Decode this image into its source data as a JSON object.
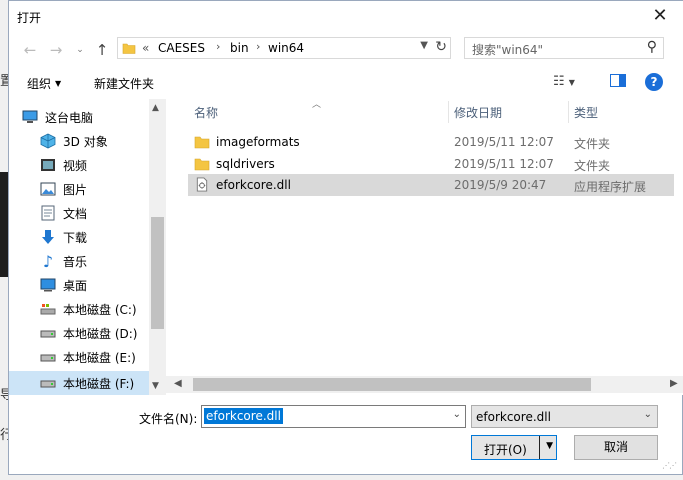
{
  "dialog": {
    "title": "打开",
    "close_glyph": "✕"
  },
  "address": {
    "overflow": "«",
    "crumbs": [
      "CAESES",
      "bin",
      "win64"
    ],
    "separator": "›"
  },
  "search": {
    "placeholder": "搜索\"win64\""
  },
  "toolbar": {
    "organize": "组织",
    "new_folder": "新建文件夹",
    "help": "?"
  },
  "nav": {
    "items": [
      {
        "label": "这台电脑",
        "icon": "computer-icon"
      },
      {
        "label": "3D 对象",
        "icon": "3d-objects-icon"
      },
      {
        "label": "视频",
        "icon": "video-icon"
      },
      {
        "label": "图片",
        "icon": "pictures-icon"
      },
      {
        "label": "文档",
        "icon": "documents-icon"
      },
      {
        "label": "下载",
        "icon": "download-icon"
      },
      {
        "label": "音乐",
        "icon": "music-icon"
      },
      {
        "label": "桌面",
        "icon": "desktop-icon"
      },
      {
        "label": "本地磁盘 (C:)",
        "icon": "drive-c-icon"
      },
      {
        "label": "本地磁盘 (D:)",
        "icon": "drive-icon"
      },
      {
        "label": "本地磁盘 (E:)",
        "icon": "drive-icon"
      },
      {
        "label": "本地磁盘 (F:)",
        "icon": "drive-icon"
      }
    ]
  },
  "filelist": {
    "columns": [
      "名称",
      "修改日期",
      "类型"
    ],
    "rows": [
      {
        "name": "imageformats",
        "date": "2019/5/11 12:07",
        "type": "文件夹",
        "icon": "folder-icon"
      },
      {
        "name": "sqldrivers",
        "date": "2019/5/11 12:07",
        "type": "文件夹",
        "icon": "folder-icon"
      },
      {
        "name": "eforkcore.dll",
        "date": "2019/5/9 20:47",
        "type": "应用程序扩展",
        "icon": "dll-file-icon"
      }
    ]
  },
  "footer": {
    "filename_label": "文件名(N):",
    "filename_value": "eforkcore.dll",
    "filetype_value": "eforkcore.dll",
    "open_label": "打开(O)",
    "cancel_label": "取消"
  },
  "background": {
    "glyphs": [
      "置",
      "导",
      "行"
    ]
  },
  "colors": {
    "accent": "#0078d7",
    "selection": "#cce4f7",
    "folder": "#f4c542"
  }
}
